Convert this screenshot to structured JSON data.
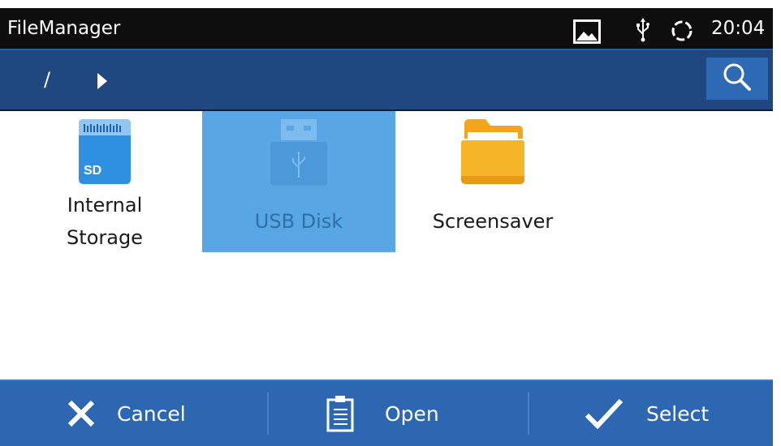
{
  "status_bar": {
    "app_title": "FileManager",
    "time": "20:04",
    "icons": [
      "image-icon",
      "usb-icon",
      "sync-icon"
    ]
  },
  "path_bar": {
    "path": "/",
    "search_icon": "search-icon"
  },
  "items": [
    {
      "label_line1": "Internal",
      "label_line2": "Storage",
      "icon": "sd-card-icon",
      "sd_text": "SD"
    },
    {
      "label": "USB Disk",
      "icon": "usb-drive-icon",
      "selected": true
    },
    {
      "label": "Screensaver",
      "icon": "folder-icon"
    }
  ],
  "actions": {
    "cancel": "Cancel",
    "open": "Open",
    "select": "Select"
  },
  "colors": {
    "status_bar": "#0e0e0e",
    "path_bar": "#1f4780",
    "selection": "#58a6e4",
    "bottom_bar": "#2d67b1"
  }
}
